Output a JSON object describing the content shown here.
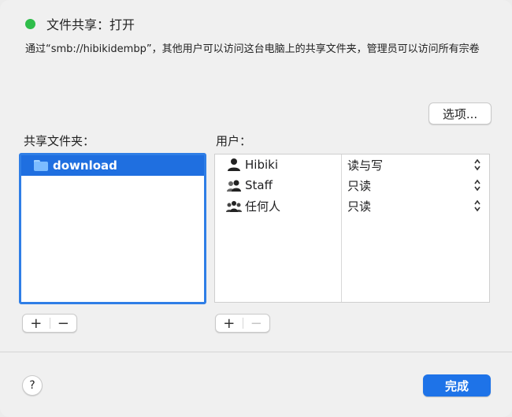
{
  "status": {
    "text": "文件共享：打开",
    "color": "#2fbd4a"
  },
  "description": "通过“smb://hibikidembp”，其他用户可以访问这台电脑上的共享文件夹，管理员可以访问所有宗卷",
  "options_button": "选项...",
  "shared_folders": {
    "label": "共享文件夹：",
    "items": [
      {
        "name": "download",
        "icon": "folder-icon"
      }
    ],
    "add_label": "+",
    "remove_label": "−"
  },
  "users": {
    "label": "用户：",
    "rows": [
      {
        "name": "Hibiki",
        "permission": "读与写",
        "icon": "single-user-icon"
      },
      {
        "name": "Staff",
        "permission": "只读",
        "icon": "group-icon"
      },
      {
        "name": "任何人",
        "permission": "只读",
        "icon": "everyone-icon"
      }
    ],
    "add_label": "+",
    "remove_label": "−"
  },
  "help_button": "?",
  "done_button": "完成",
  "colors": {
    "accent": "#1e73e8",
    "selection": "#1f6fe0"
  }
}
